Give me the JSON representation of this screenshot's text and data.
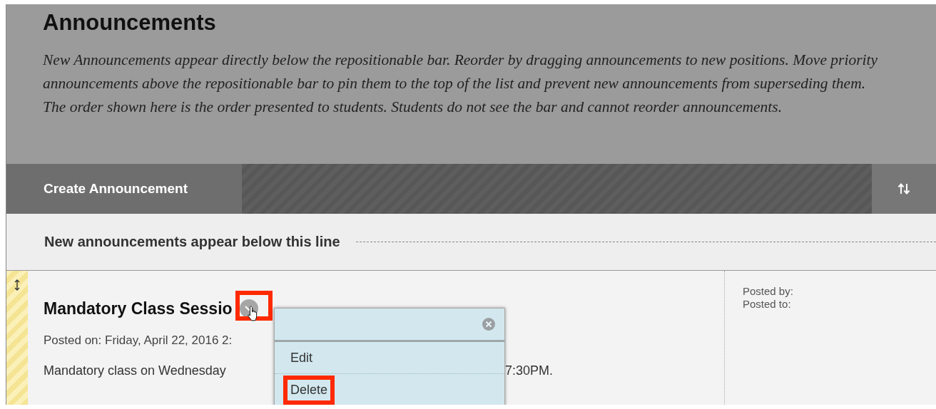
{
  "page": {
    "title": "Announcements",
    "description": "New Announcements appear directly below the repositionable bar. Reorder by dragging announcements to new positions. Move priority announcements above the repositionable bar to pin them to the top of the list and prevent new announcements from superseding them. The order shown here is the order presented to students. Students do not see the bar and cannot reorder announcements."
  },
  "action_bar": {
    "create_button": "Create Announcement"
  },
  "divider_line": {
    "label": "New announcements appear below this line"
  },
  "announcements": [
    {
      "title": "Mandatory Class Sessio",
      "posted_on": "Posted on: Friday, April 22, 2016 2:",
      "body_parts": [
        "Mandatory class on Wednesday",
        "7:30PM."
      ],
      "posted_by": "Posted by:",
      "posted_to": "Posted to:",
      "menu_open": true,
      "menu_button_highlighted": true
    }
  ],
  "context_menu": {
    "items": [
      {
        "label": "Edit",
        "highlighted": false
      },
      {
        "label": "Delete",
        "highlighted": true
      }
    ]
  }
}
